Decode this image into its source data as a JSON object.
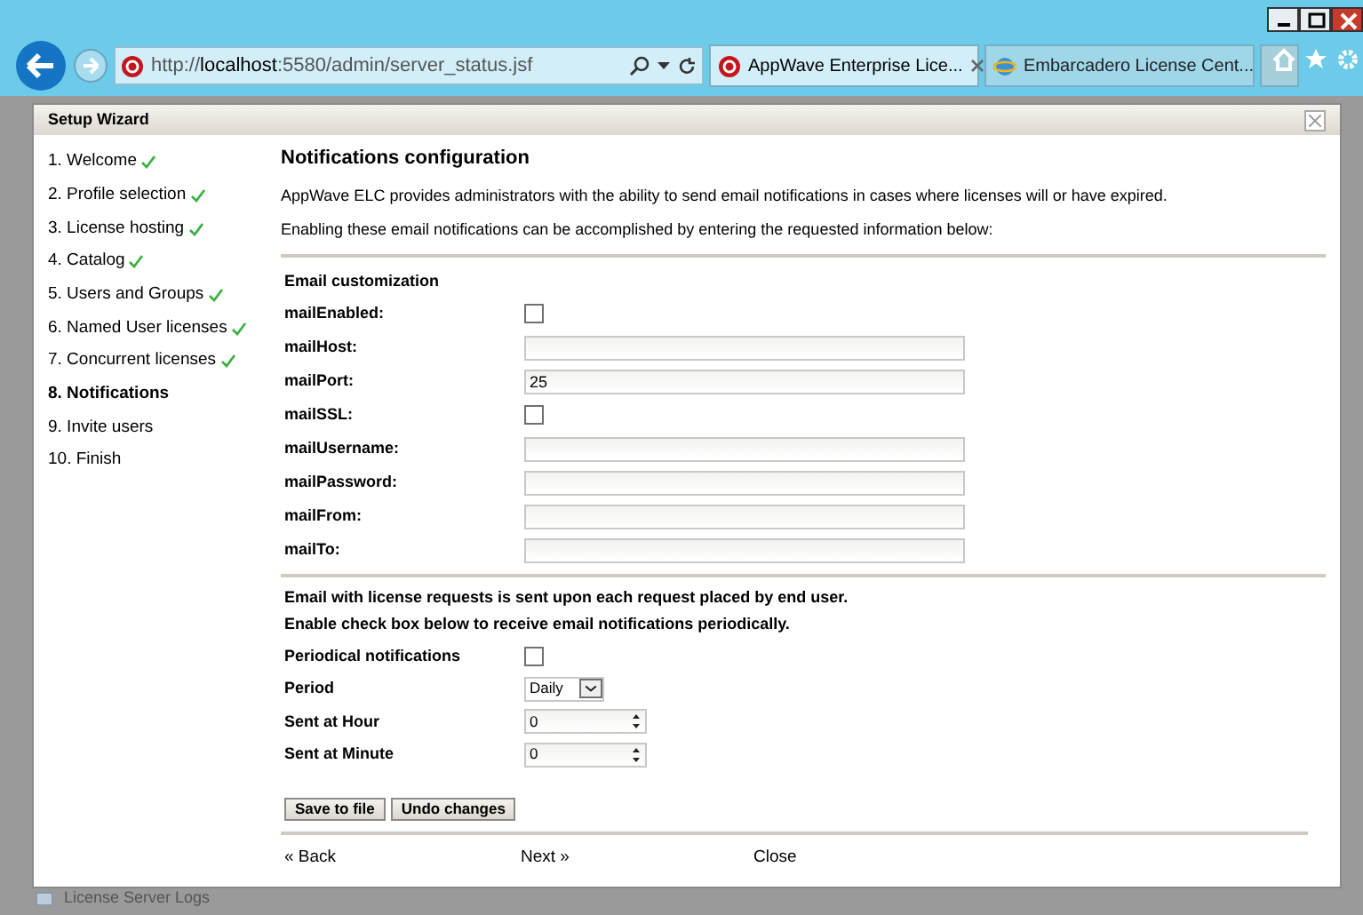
{
  "browser": {
    "address": {
      "prefix": "http://",
      "host": "localhost",
      "rest": ":5580/admin/server_status.jsf"
    },
    "tabs": [
      {
        "label": "AppWave Enterprise Lice...",
        "selected": true
      },
      {
        "label": "Embarcadero License Cent...",
        "selected": false
      }
    ]
  },
  "dialog": {
    "title": "Setup Wizard",
    "steps": [
      {
        "label": "1. Welcome",
        "done": true,
        "selected": false
      },
      {
        "label": "2. Profile selection",
        "done": true,
        "selected": false
      },
      {
        "label": "3. License hosting",
        "done": true,
        "selected": false
      },
      {
        "label": "4. Catalog",
        "done": true,
        "selected": false
      },
      {
        "label": "5. Users and Groups",
        "done": true,
        "selected": false
      },
      {
        "label": "6. Named User licenses",
        "done": true,
        "selected": false
      },
      {
        "label": "7. Concurrent licenses",
        "done": true,
        "selected": false
      },
      {
        "label": "8. Notifications",
        "done": false,
        "selected": true
      },
      {
        "label": "9. Invite users",
        "done": false,
        "selected": false
      },
      {
        "label": "10. Finish",
        "done": false,
        "selected": false
      }
    ],
    "heading": "Notifications configuration",
    "intro": [
      "AppWave ELC provides administrators with the ability to send email notifications in cases where licenses will or have expired.",
      "Enabling these email notifications can be accomplished by entering the requested information below:"
    ],
    "email_section": {
      "title": "Email customization",
      "fields": [
        {
          "label": "mailEnabled:",
          "kind": "checkbox",
          "checked": false
        },
        {
          "label": "mailHost:",
          "kind": "text"
        },
        {
          "label": "mailPort:",
          "kind": "text",
          "value": "25"
        },
        {
          "label": "mailSSL:",
          "kind": "checkbox",
          "checked": false
        },
        {
          "label": "mailUsername:",
          "kind": "text"
        },
        {
          "label": "mailPassword:",
          "kind": "text"
        },
        {
          "label": "mailFrom:",
          "kind": "text"
        },
        {
          "label": "mailTo:",
          "kind": "text"
        }
      ]
    },
    "periodic_section": {
      "notes": [
        "Email with license requests is sent upon each request placed by end user.",
        "Enable check box below to receive email notifications periodically."
      ],
      "fields": [
        {
          "label": "Periodical notifications",
          "kind": "checkbox",
          "checked": false
        },
        {
          "label": "Period",
          "kind": "select",
          "value": "Daily"
        },
        {
          "label": "Sent at Hour",
          "kind": "spinner",
          "value": "0"
        },
        {
          "label": "Sent at Minute",
          "kind": "spinner",
          "value": "0"
        }
      ]
    },
    "buttons": [
      "Save to file",
      "Undo changes"
    ],
    "nav": {
      "back": "« Back",
      "next": "Next »",
      "close": "Close"
    }
  },
  "background": {
    "item": "License Server Logs"
  }
}
